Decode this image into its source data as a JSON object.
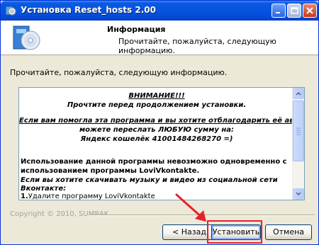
{
  "window": {
    "title": "Установка Reset_hosts 2.00"
  },
  "header": {
    "title": "Информация",
    "subtitle": "Прочитайте, пожалуйста, следующую информацию."
  },
  "intro_text": "Прочитайте, пожалуйста, следующую информацию.",
  "content": {
    "lines": [
      "ВНИМАНИЕ!!!",
      "Прочтите перед продолжением установки.",
      "Если вам помогла эта программа и вы хотите отблагодарить её автора",
      "можете переслать ЛЮБУЮ сумму на:",
      "Яндекс кошелёк 41001484268270 =)",
      "Использование данной программы невозможно одновременно с",
      "использованием программы LoviVkontakte.",
      "Если вы хотите скачивать музыку и видео из социальной сети",
      "Вконтакте:",
      "1.",
      "Удалите программу LoviVkontakte"
    ]
  },
  "footer": {
    "copyright": "Copyright © 2010, SUMRAK"
  },
  "buttons": {
    "back": "< Назад",
    "install": "Установить",
    "cancel": "Отмена"
  },
  "colors": {
    "titlebar": "#0654e0",
    "highlight": "#e8202a",
    "dialog_bg": "#ece9d8"
  },
  "icons": {
    "title": "installer-cd-icon",
    "header": "installer-cd-box-icon",
    "annotation": "red-arrow-annotation"
  }
}
